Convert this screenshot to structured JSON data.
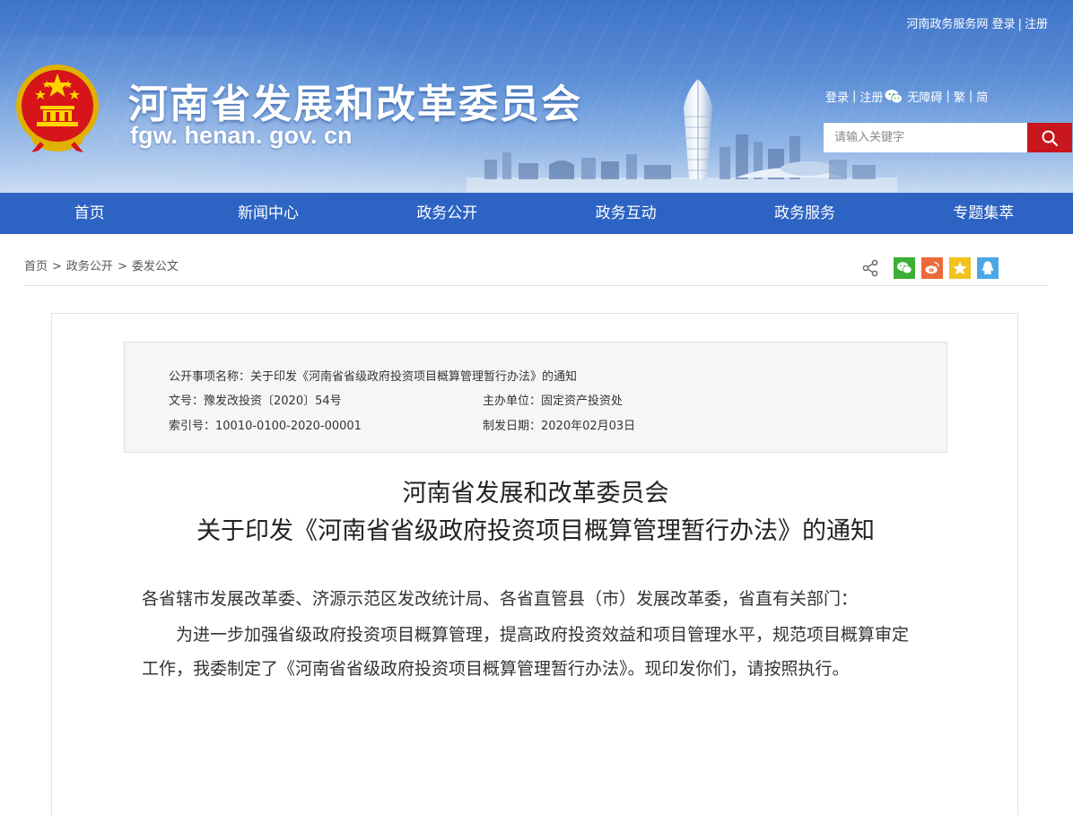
{
  "header": {
    "top_links": {
      "portal": "河南政务服务网",
      "login": "登录",
      "register": "注册"
    },
    "site_title": "河南省发展和改革委员会",
    "site_domain": "fgw. henan. gov. cn",
    "util_links": {
      "login": "登录",
      "register": "注册",
      "accessibility": "无障碍",
      "traditional": "繁",
      "simplified": "简"
    },
    "search": {
      "placeholder": "请输入关键字"
    }
  },
  "nav": {
    "items": [
      {
        "label": "首页"
      },
      {
        "label": "新闻中心"
      },
      {
        "label": "政务公开"
      },
      {
        "label": "政务互动"
      },
      {
        "label": "政务服务"
      },
      {
        "label": "专题集萃"
      }
    ]
  },
  "breadcrumb": {
    "items": [
      "首页",
      "政务公开",
      "委发公文"
    ],
    "separator": ">"
  },
  "share": {
    "icons": [
      "share-icon",
      "wechat-icon",
      "weibo-icon",
      "qzone-icon",
      "qq-icon"
    ],
    "colors": {
      "wechat": "#3cb034",
      "weibo": "#ec6a3a",
      "qzone": "#f2c21c",
      "qq": "#4aa8e8"
    }
  },
  "meta": {
    "item_name": "公开事项名称：关于印发《河南省省级政府投资项目概算管理暂行办法》的通知",
    "doc_no": "文号：豫发改投资〔2020〕54号",
    "host_unit": "主办单位：固定资产投资处",
    "index_no": "索引号：10010-0100-2020-00001",
    "issue_date": "制发日期：2020年02月03日"
  },
  "document": {
    "title_line1": "河南省发展和改革委员会",
    "title_line2": "关于印发《河南省省级政府投资项目概算管理暂行办法》的通知",
    "addressee": "各省辖市发展改革委、济源示范区发改统计局、各省直管县（市）发展改革委，省直有关部门：",
    "paragraph1": "为进一步加强省级政府投资项目概算管理，提高政府投资效益和项目管理水平，规范项目概算审定工作，我委制定了《河南省省级政府投资项目概算管理暂行办法》。现印发你们，请按照执行。"
  },
  "colors": {
    "nav_bg": "#2d63c3",
    "search_button": "#c8161d",
    "banner_top": "#3e73c8"
  }
}
